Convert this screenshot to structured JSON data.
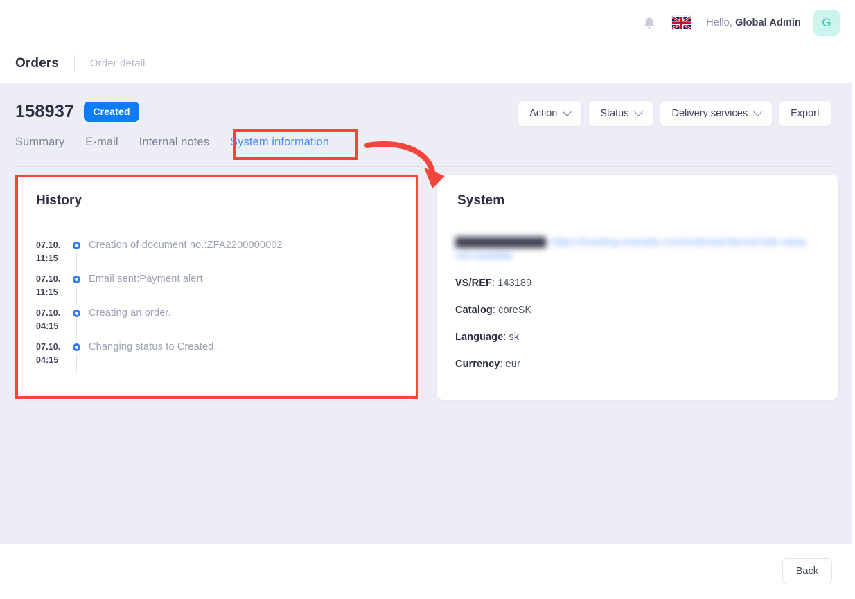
{
  "topbar": {
    "notification_icon": "bell-icon",
    "language_flag": "uk-flag-icon",
    "greeting_prefix": "Hello,",
    "user_name": "Global Admin",
    "avatar_initial": "G"
  },
  "breadcrumb": {
    "parent": "Orders",
    "current": "Order detail"
  },
  "header": {
    "order_number": "158937",
    "status_label": "Created",
    "status_color": "#0d7cf7"
  },
  "toolbar": {
    "buttons": [
      {
        "label": "Action",
        "has_caret": true
      },
      {
        "label": "Status",
        "has_caret": true
      },
      {
        "label": "Delivery services",
        "has_caret": true
      },
      {
        "label": "Export",
        "has_caret": false
      }
    ]
  },
  "tabs": [
    {
      "label": "Summary",
      "active": false
    },
    {
      "label": "E-mail",
      "active": false
    },
    {
      "label": "Internal notes",
      "active": false
    },
    {
      "label": "System information",
      "active": true
    }
  ],
  "history": {
    "title": "History",
    "entries": [
      {
        "date": "07.10.",
        "time": "11:15",
        "text": "Creation of document no.:ZFA2200000002"
      },
      {
        "date": "07.10.",
        "time": "11:15",
        "text": "Email sent:Payment alert"
      },
      {
        "date": "07.10.",
        "time": "04:15",
        "text": "Creating an order."
      },
      {
        "date": "07.10.",
        "time": "04:15",
        "text": "Changing status to Created."
      }
    ]
  },
  "system": {
    "title": "System",
    "rows": [
      {
        "label": "Shipment Tracking",
        "value": "https://tracking.example.com/redacted-blurred-link-value-not-readable",
        "redacted": true
      },
      {
        "label": "VS/REF",
        "value": "143189",
        "redacted": false
      },
      {
        "label": "Catalog",
        "value": "coreSK",
        "redacted": false
      },
      {
        "label": "Language",
        "value": "sk",
        "redacted": false
      },
      {
        "label": "Currency",
        "value": "eur",
        "redacted": false
      }
    ]
  },
  "footer": {
    "back_label": "Back"
  },
  "annotations": {
    "highlight_color": "#f7443c",
    "boxes": [
      "system-information-tab",
      "history-card"
    ],
    "arrow": "curved-arrow-pointing-to-history-card"
  }
}
